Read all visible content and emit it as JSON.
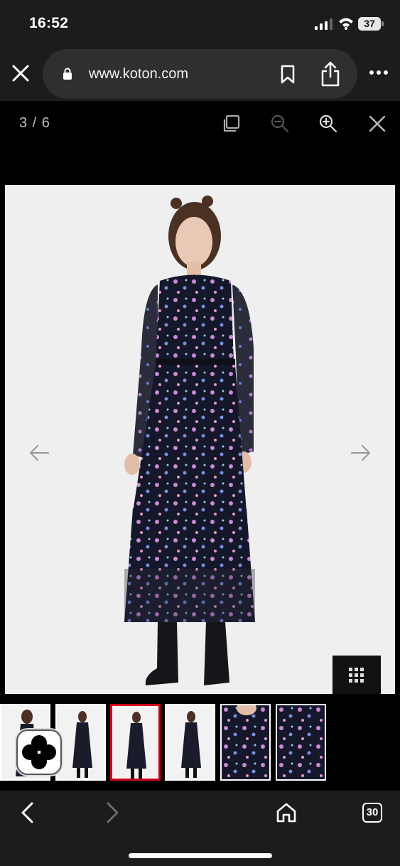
{
  "status": {
    "time": "16:52",
    "battery": "37"
  },
  "browser": {
    "url": "www.koton.com",
    "open_tabs": "30"
  },
  "gallery": {
    "counter": "3 / 6",
    "current_index": 3,
    "total": 6
  },
  "thumbnails": [
    {
      "label": "product-photo-1"
    },
    {
      "label": "product-photo-2"
    },
    {
      "label": "product-photo-3",
      "active": true
    },
    {
      "label": "product-photo-4"
    },
    {
      "label": "product-photo-5"
    },
    {
      "label": "product-photo-6"
    }
  ],
  "icons": {
    "close_tab": "close-icon",
    "lock": "lock-icon",
    "bookmark": "bookmark-icon",
    "share": "share-icon",
    "more": "more-icon",
    "copy": "copy-icon",
    "zoom_out": "zoom-out-icon",
    "zoom_in": "zoom-in-icon",
    "close_gallery": "close-icon",
    "prev": "arrow-left-icon",
    "next": "arrow-right-icon",
    "grid": "grid-icon",
    "back": "chevron-left-icon",
    "forward": "chevron-right-icon",
    "home": "home-icon"
  },
  "colors": {
    "active_thumb_border": "#d0021b",
    "background": "#000000",
    "chrome": "#1c1c1e"
  }
}
